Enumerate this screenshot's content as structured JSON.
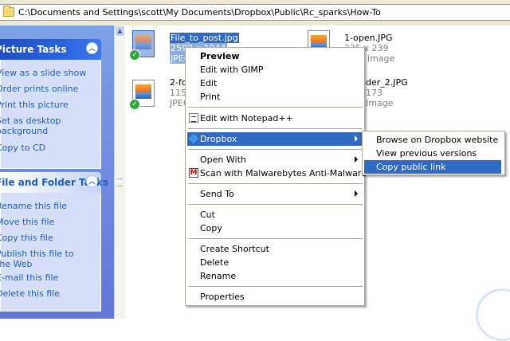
{
  "address": {
    "path": "C:\\Documents and Settings\\scott\\My Documents\\Dropbox\\Public\\Rc_sparks\\How-To",
    "icon": "folder-icon"
  },
  "task_pane": {
    "picture_tasks": {
      "title": "Picture Tasks",
      "items": [
        "View as a slide show",
        "Order prints online",
        "Print this picture",
        "Set as desktop background",
        "Copy to CD"
      ]
    },
    "file_folder_tasks": {
      "title": "File and Folder Tasks",
      "items": [
        "Rename this file",
        "Move this file",
        "Copy this file",
        "Publish this file to the Web",
        "E-mail this file",
        "Delete this file"
      ]
    }
  },
  "files": [
    {
      "name": "File_to_post.jpg",
      "dims": "2592 x 1944",
      "type": "JPEG Image",
      "selected": true
    },
    {
      "name": "1-open.JPG",
      "dims": "225 x 239",
      "type": "JPEG Image",
      "selected": false
    },
    {
      "name": "2-fo",
      "dims": "115",
      "type": "JPEG",
      "selected": false
    },
    {
      "name": "der_2.JPG",
      "dims": "173",
      "type": "Image",
      "selected": false
    }
  ],
  "context_menu": {
    "items": {
      "preview": "Preview",
      "edit_gimp": "Edit with GIMP",
      "edit": "Edit",
      "print": "Print",
      "edit_notepad": "Edit with Notepad++",
      "dropbox": "Dropbox",
      "open_with": "Open With",
      "malwarebytes": "Scan with Malwarebytes Anti-Malware",
      "send_to": "Send To",
      "cut": "Cut",
      "copy": "Copy",
      "create_shortcut": "Create Shortcut",
      "delete": "Delete",
      "rename": "Rename",
      "properties": "Properties"
    }
  },
  "dropbox_submenu": {
    "items": [
      "Browse on Dropbox website",
      "View previous versions",
      "Copy public link"
    ],
    "highlighted": "Copy public link"
  },
  "colors": {
    "selection": "#316ac5",
    "task_link": "#215dc6",
    "pane_bg": "#7ba2e7"
  }
}
